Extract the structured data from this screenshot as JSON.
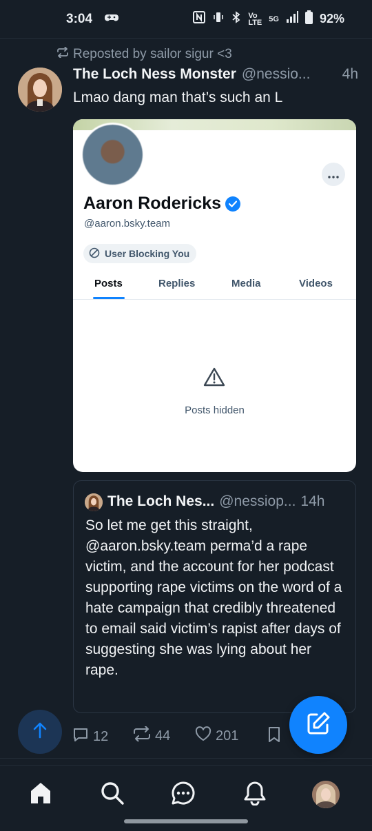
{
  "status_bar": {
    "time": "3:04",
    "volte_top": "Vo",
    "volte_bottom": "LTE",
    "network": "5G",
    "battery": "92%"
  },
  "post": {
    "repost_label": "Reposted by sailor sigur <3",
    "author_name": "The Loch Ness Monster",
    "author_handle": "@nessio...",
    "time": "4h",
    "text": "Lmao dang man that’s such an L"
  },
  "embed": {
    "profile_name": "Aaron Rodericks",
    "profile_handle": "@aaron.bsky.team",
    "blocking_label": "User Blocking You",
    "tabs": [
      "Posts",
      "Replies",
      "Media",
      "Videos"
    ],
    "active_tab": "Posts",
    "hidden_label": "Posts hidden"
  },
  "quote": {
    "author_name": "The Loch Nes...",
    "author_handle": "@nessiop...",
    "time": "14h",
    "text": "So let me get this straight, @aaron.bsky.team perma’d a rape victim, and the account for her podcast supporting rape victims on the word of a hate campaign that credibly threatened to email said victim’s rapist after days of suggesting she was lying about her rape."
  },
  "actions": {
    "replies": "12",
    "reposts": "44",
    "likes": "201"
  },
  "colors": {
    "background": "#161e27",
    "accent": "#1083fe",
    "muted_text": "#8e9aa7"
  }
}
